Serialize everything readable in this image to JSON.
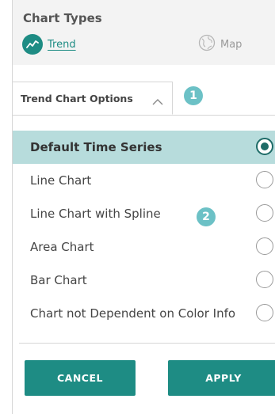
{
  "chart_types": {
    "title": "Chart Types",
    "items": [
      {
        "label": "Trend",
        "icon": "trend-line-icon",
        "active": true
      },
      {
        "label": "Map",
        "icon": "globe-icon",
        "active": false
      }
    ]
  },
  "tab": {
    "label": "Trend Chart Options",
    "icon": "chevron-up-icon"
  },
  "callouts": [
    "1",
    "2"
  ],
  "options": [
    {
      "label": "Default Time Series",
      "selected": true
    },
    {
      "label": "Line Chart",
      "selected": false
    },
    {
      "label": "Line Chart with Spline",
      "selected": false
    },
    {
      "label": "Area Chart",
      "selected": false
    },
    {
      "label": "Bar Chart",
      "selected": false
    },
    {
      "label": "Chart not Dependent on Color Info",
      "selected": false
    }
  ],
  "buttons": {
    "cancel": "CANCEL",
    "apply": "APPLY"
  },
  "colors": {
    "accent": "#1e8c84",
    "selected_row": "#b7dcdc",
    "callout": "#6cc1c6"
  }
}
